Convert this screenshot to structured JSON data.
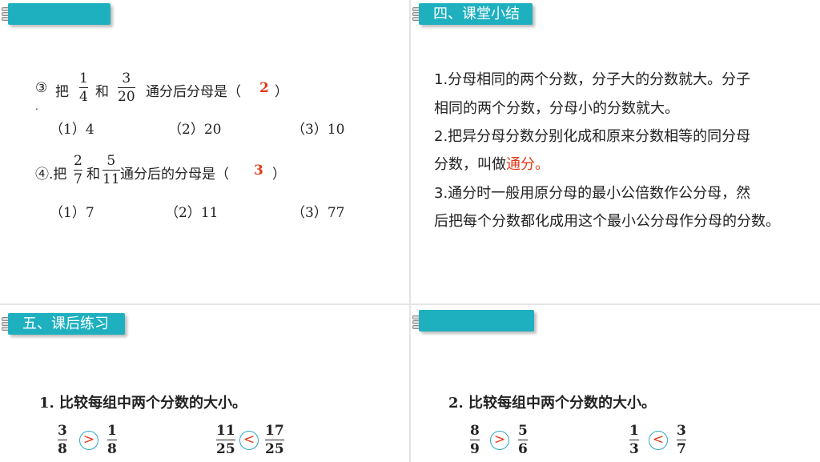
{
  "slide1": {
    "banner": "",
    "q3": {
      "num": "③",
      "prefix": "把",
      "frac1": {
        "n": "1",
        "d": "4"
      },
      "and": "和",
      "frac2": {
        "n": "3",
        "d": "20"
      },
      "suffix": "通分后分母是（",
      "answer": "2",
      "close": "）",
      "dot": ".",
      "options": [
        "（1）4",
        "（2）20",
        "（3）10"
      ]
    },
    "q4": {
      "prefix": "④.把",
      "frac1": {
        "n": "2",
        "d": "7"
      },
      "and": "和",
      "frac2": {
        "n": "5",
        "d": "11"
      },
      "suffix": "通分后的分母是（",
      "answer": "3",
      "close": "）",
      "options": [
        "（1）7",
        "（2）11",
        "（3）77"
      ]
    }
  },
  "slide2": {
    "banner": "四、课堂小结",
    "lines": [
      "1.分母相同的两个分数，分子大的分数就大。分子",
      "相同的两个分数，分母小的分数就大。",
      "2.把异分母分数分别化成和原来分数相等的同分母",
      "分数，叫做",
      "通分。",
      "3.通分时一般用原分母的最小公倍数作公分母，然",
      "后把每个分数都化成用这个最小公分母作分母的分数。"
    ]
  },
  "slide3": {
    "banner": "五、课后练习",
    "question": "1. 比较每组中两个分数的大小。",
    "pairs": [
      {
        "a": {
          "n": "3",
          "d": "8"
        },
        "sign": ">",
        "b": {
          "n": "1",
          "d": "8"
        }
      },
      {
        "a": {
          "n": "11",
          "d": "25"
        },
        "sign": "<",
        "b": {
          "n": "17",
          "d": "25"
        }
      }
    ]
  },
  "slide4": {
    "banner": "",
    "question": "2. 比较每组中两个分数的大小。",
    "pairs": [
      {
        "a": {
          "n": "8",
          "d": "9"
        },
        "sign": ">",
        "b": {
          "n": "5",
          "d": "6"
        }
      },
      {
        "a": {
          "n": "1",
          "d": "3"
        },
        "sign": "<",
        "b": {
          "n": "3",
          "d": "7"
        }
      }
    ]
  },
  "colors": {
    "banner": "#1fb0c0",
    "answer": "#e23b1a",
    "circle": "#2aa6c4"
  }
}
